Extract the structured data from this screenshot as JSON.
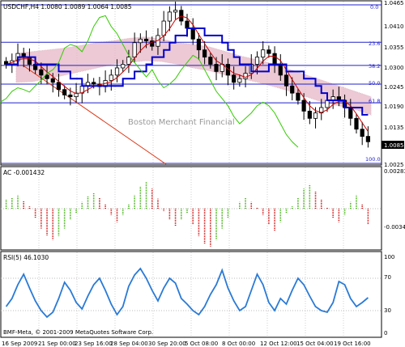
{
  "main": {
    "header": "USDCHF,H4  1.0080 1.0089 1.0064 1.0085",
    "watermark": "Boston Merchant Financial",
    "price_axis": [
      "1.0465",
      "1.0410",
      "1.0355",
      "1.0300",
      "1.0245",
      "1.0190",
      "1.0135",
      "1.0085",
      "1.0025"
    ],
    "current_price": "1.0085",
    "fib_levels": [
      "0.0",
      "23.6",
      "38.2",
      "50.0",
      "61.8",
      "100.0"
    ]
  },
  "ac": {
    "header": "AC -0.001432",
    "axis_top": "0.002834",
    "axis_bottom": "-0.003466"
  },
  "rsi": {
    "header": "RSI(5) 46.1030",
    "axis": [
      "100",
      "70",
      "30",
      "0"
    ]
  },
  "copyright": "BMF-Meta, © 2001-2009 MetaQuotes Software Corp.",
  "time_axis": [
    "16 Sep 2009",
    "21 Sep 00:00",
    "23 Sep 16:00",
    "28 Sep 04:00",
    "30 Sep 20:00",
    "5 Oct 08:00",
    "8 Oct 00:00",
    "12 Oct 12:00",
    "15 Oct 04:00",
    "19 Oct 16:00"
  ],
  "colors": {
    "kijun": "#0000cc",
    "tenkan": "#cc0000",
    "chikou": "#33cc00",
    "cloud": "#e6b8c6",
    "ac_up": "#33aa00",
    "ac_down": "#cc0000",
    "rsi": "#2a7ad6",
    "trend": "#dd3311"
  },
  "chart_data": {
    "type": "candlestick",
    "symbol": "USDCHF",
    "timeframe": "H4",
    "ohlc_last": {
      "open": 1.008,
      "high": 1.0089,
      "low": 1.0064,
      "close": 1.0085
    },
    "ylim": [
      1.0025,
      1.0465
    ],
    "fib_pct": [
      0.0,
      23.6,
      38.2,
      50.0,
      61.8,
      100.0
    ],
    "close_path": [
      1.03,
      1.031,
      1.033,
      1.032,
      1.03,
      1.0285,
      1.027,
      1.026,
      1.025,
      1.023,
      1.0215,
      1.021,
      1.022,
      1.024,
      1.025,
      1.0245,
      1.0238,
      1.0255,
      1.027,
      1.029,
      1.03,
      1.032,
      1.036,
      1.037,
      1.0365,
      1.035,
      1.038,
      1.042,
      1.0445,
      1.045,
      1.042,
      1.04,
      1.037,
      1.034,
      1.032,
      1.03,
      1.028,
      1.03,
      1.027,
      1.025,
      1.026,
      1.0275,
      1.03,
      1.032,
      1.034,
      1.033,
      1.03,
      1.027,
      1.024,
      1.022,
      1.02,
      1.017,
      1.015,
      1.0165,
      1.018,
      1.02,
      1.021,
      1.02,
      1.018,
      1.015,
      1.012,
      1.01,
      1.0085
    ],
    "ac_values": [
      0.0008,
      0.001,
      0.0012,
      0.0007,
      0.0002,
      -0.0008,
      -0.0018,
      -0.0024,
      -0.0028,
      -0.0025,
      -0.0018,
      -0.001,
      -0.0004,
      0.0006,
      0.0011,
      0.0014,
      0.001,
      0.0004,
      -0.0006,
      -0.0012,
      -0.0006,
      0.0004,
      0.0012,
      0.002,
      0.0024,
      0.0018,
      0.0009,
      -0.0002,
      -0.001,
      -0.0016,
      -0.001,
      -0.0004,
      -0.0014,
      -0.0025,
      -0.0032,
      -0.0034,
      -0.0028,
      -0.0018,
      -0.0008,
      0.0,
      0.0006,
      0.001,
      0.0006,
      0.0001,
      -0.0006,
      -0.0014,
      -0.002,
      -0.0012,
      -0.0004,
      0.0002,
      0.001,
      0.0018,
      0.0022,
      0.0016,
      0.0008,
      0.0001,
      -0.0008,
      -0.0012,
      -0.0006,
      0.0006,
      0.0012,
      0.0004,
      -0.0014
    ],
    "rsi_values": [
      35,
      45,
      62,
      75,
      58,
      42,
      30,
      22,
      28,
      45,
      65,
      55,
      40,
      32,
      48,
      62,
      70,
      55,
      38,
      25,
      35,
      60,
      74,
      82,
      70,
      55,
      42,
      58,
      70,
      64,
      45,
      38,
      30,
      25,
      35,
      50,
      62,
      80,
      58,
      42,
      30,
      35,
      55,
      75,
      62,
      40,
      30,
      45,
      38,
      55,
      70,
      62,
      48,
      35,
      30,
      28,
      40,
      66,
      62,
      45,
      35,
      40,
      46
    ]
  }
}
